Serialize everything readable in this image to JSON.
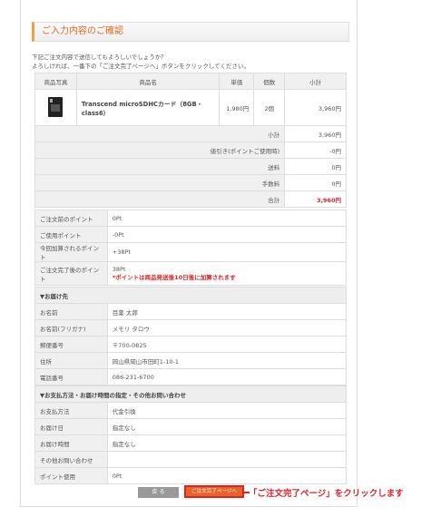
{
  "title": "ご入力内容のご確認",
  "intro": [
    "下記ご注文内容で送信してもよろしいでしょうか？",
    "よろしければ、一番下の「ご注文完了ページへ」ボタンをクリックしてください。"
  ],
  "cart": {
    "headers": [
      "商品写真",
      "商品名",
      "単価",
      "個数",
      "小計"
    ],
    "item": {
      "name": "Transcend microSDHCカード（8GB・class6）",
      "price": "1,980円",
      "qty": "2個",
      "subtotal": "3,960円"
    },
    "totals": [
      {
        "label": "小計",
        "value": "3,960円"
      },
      {
        "label": "値引き(ポイントご使用時)",
        "value": "-0円"
      },
      {
        "label": "送料",
        "value": "0円"
      },
      {
        "label": "手数料",
        "value": "0円"
      },
      {
        "label": "合計",
        "value": "3,960円"
      }
    ]
  },
  "points": [
    {
      "label": "ご注文前のポイント",
      "value": "0Pt"
    },
    {
      "label": "ご使用ポイント",
      "value": "-0Pt"
    },
    {
      "label": "今回加算されるポイント",
      "value": "+38Pt"
    },
    {
      "label": "ご注文完了後のポイント",
      "value": "38Pt",
      "note": "*ポイントは商品発送後10日後に加算されます"
    }
  ],
  "delivery": {
    "title": "▼お届け先",
    "rows": [
      {
        "label": "お名前",
        "value": "目薬 太郎"
      },
      {
        "label": "お名前(フリガナ)",
        "value": "メモリ タロウ"
      },
      {
        "label": "郵便番号",
        "value": "〒700-0825"
      },
      {
        "label": "住所",
        "value": "岡山県岡山市田町1-10-1"
      },
      {
        "label": "電話番号",
        "value": "086-231-6700"
      }
    ]
  },
  "payment": {
    "title": "▼お支払方法・お届け時間の指定・その他お問い合わせ",
    "rows": [
      {
        "label": "お支払方法",
        "value": "代金引換"
      },
      {
        "label": "お届け日",
        "value": "指定なし"
      },
      {
        "label": "お届け時間",
        "value": "指定なし"
      },
      {
        "label": "その他お問い合わせ",
        "value": ""
      },
      {
        "label": "ポイント使用",
        "value": "0Pt"
      }
    ]
  },
  "buttons": {
    "back": "戻 る",
    "next": "ご注文完了ページへ"
  },
  "callout": "「ご注文完了ページ」をクリックします",
  "colors": {
    "accent": "#e8632a",
    "red": "#d9232d"
  }
}
